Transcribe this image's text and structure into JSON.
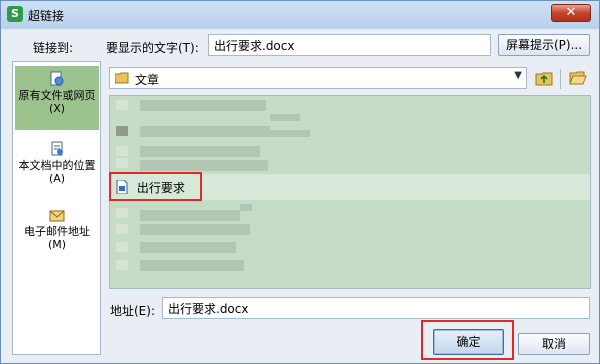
{
  "window": {
    "title": "超链接",
    "app_icon": "S",
    "close_symbol": "✕"
  },
  "link_to_label": "链接到:",
  "display_text": {
    "label": "要显示的文字(T):",
    "value": "出行要求.docx"
  },
  "screentip_button": "屏幕提示(P)...",
  "nav": [
    {
      "label": "原有文件或网页(X)",
      "icon": "file-web-icon",
      "selected": true
    },
    {
      "label": "本文档中的位置(A)",
      "icon": "document-place-icon",
      "selected": false
    },
    {
      "label": "电子邮件地址(M)",
      "icon": "email-icon",
      "selected": false
    }
  ],
  "folder": {
    "name": "文章",
    "icon": "folder-icon"
  },
  "file_list": {
    "selected_item": "出行要求"
  },
  "address": {
    "label": "地址(E):",
    "value": "出行要求.docx"
  },
  "buttons": {
    "ok": "确定",
    "cancel": "取消"
  },
  "colors": {
    "selected_nav": "#9cc38e",
    "list_bg": "#c5dcc6",
    "highlight": "#e02a2a"
  }
}
